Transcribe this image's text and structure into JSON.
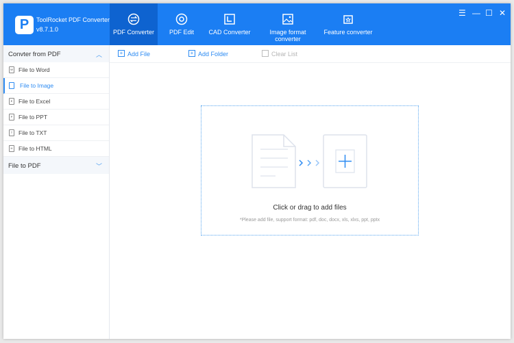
{
  "app": {
    "name": "ToolRocket PDF Converter",
    "version": "v8.7.1.0"
  },
  "tabs": [
    {
      "label": "PDF Converter"
    },
    {
      "label": "PDF Edit"
    },
    {
      "label": "CAD Converter"
    },
    {
      "label": "Image format",
      "label2": "converter"
    },
    {
      "label": "Feature converter"
    }
  ],
  "window_controls": {
    "menu": "☰",
    "min": "—",
    "max": "☐",
    "close": "✕"
  },
  "sidebar": {
    "group1": "Convter from PDF",
    "items": [
      {
        "label": "File to Word",
        "icon": "W"
      },
      {
        "label": "File to Image",
        "icon": "img"
      },
      {
        "label": "File to Excel",
        "icon": "E"
      },
      {
        "label": "File to PPT",
        "icon": "P"
      },
      {
        "label": "File to TXT",
        "icon": "T"
      },
      {
        "label": "File to HTML",
        "icon": "H"
      }
    ],
    "group2": "File to PDF"
  },
  "toolbar": {
    "add_file": "Add File",
    "add_folder": "Add Folder",
    "clear_list": "Clear List"
  },
  "dropzone": {
    "message": "Click or drag to add files",
    "hint": "*Please add file, support format: pdf, doc, docx, xls, xlxs, ppt, pptx"
  },
  "colors": {
    "brand": "#1b7ef3",
    "active_tab": "#0e63d0",
    "accent": "#2b8af2"
  }
}
